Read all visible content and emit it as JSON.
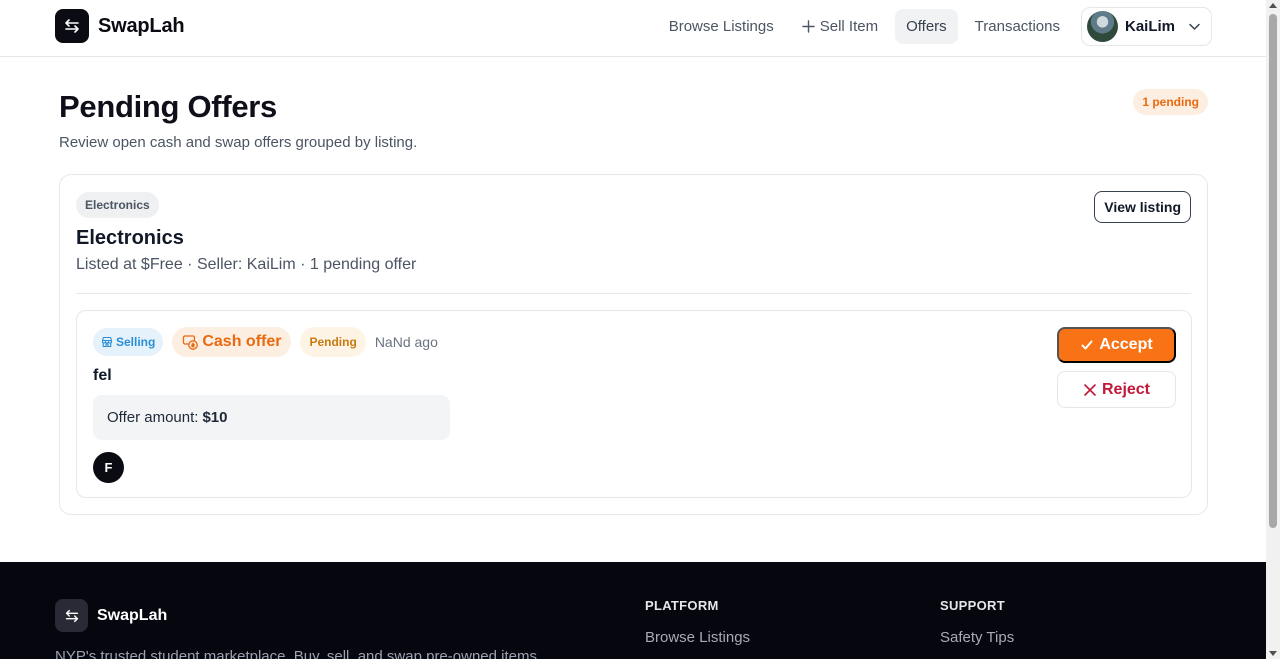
{
  "app": {
    "name": "SwapLah"
  },
  "nav": {
    "browse_label": "Browse Listings",
    "sell_label": "Sell Item",
    "offers_label": "Offers",
    "transactions_label": "Transactions",
    "user_name": "KaiLim",
    "active_tab": "Offers"
  },
  "page": {
    "title": "Pending Offers",
    "subtitle": "Review open cash and swap offers grouped by listing.",
    "pending_count": "1 pending"
  },
  "listing": {
    "category": "Electronics",
    "title": "Electronics",
    "meta": "Listed at $Free · Seller: KaiLim · 1 pending offer",
    "view_label": "View listing",
    "offer": {
      "role_badge": "Selling",
      "type_badge": "Cash offer",
      "status_badge": "Pending",
      "time": "NaNd ago",
      "offerer": "fel",
      "amount_label": "Offer amount:",
      "amount_value": "$10",
      "avatar_initial": "F",
      "accept_label": "Accept",
      "reject_label": "Reject"
    }
  },
  "footer": {
    "brand": "SwapLah",
    "description": "NYP's trusted student marketplace. Buy, sell, and swap pre-owned items.",
    "columns": [
      {
        "heading": "PLATFORM",
        "links": [
          "Browse Listings"
        ]
      },
      {
        "heading": "SUPPORT",
        "links": [
          "Safety Tips"
        ]
      }
    ]
  },
  "colors": {
    "accent": "#f97316",
    "reject": "#c2183a",
    "dark": "#0b0b14",
    "selling_badge": "#2c8fd6",
    "pending_badge": "#c97a10"
  },
  "icons": {
    "logo": "swap-arrows-icon",
    "sell": "plus-icon",
    "user_menu": "chevron-down-icon",
    "selling": "store-icon",
    "cash": "cash-icon",
    "accept": "check-icon",
    "reject": "x-icon"
  }
}
